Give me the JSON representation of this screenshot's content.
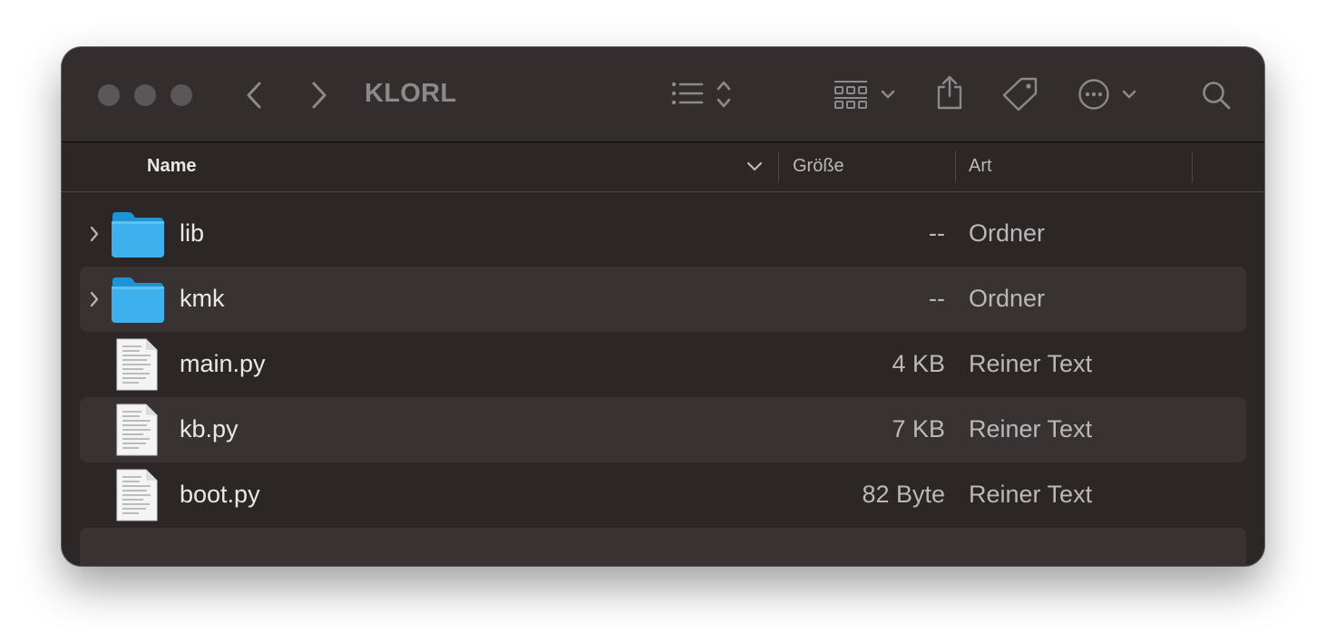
{
  "window": {
    "title": "KLORL",
    "background": "#2c2627",
    "accent_folder": "#3eb0ec"
  },
  "toolbar": {
    "icons": [
      "back-chevron-icon",
      "forward-chevron-icon",
      "list-view-icon",
      "group-grid-icon",
      "share-icon",
      "tag-icon",
      "more-actions-icon",
      "search-icon"
    ]
  },
  "columns": {
    "name": "Name",
    "size": "Größe",
    "kind": "Art"
  },
  "rows": [
    {
      "name": "lib",
      "size": "--",
      "kind": "Ordner",
      "type": "folder"
    },
    {
      "name": "kmk",
      "size": "--",
      "kind": "Ordner",
      "type": "folder"
    },
    {
      "name": "main.py",
      "size": "4 KB",
      "kind": "Reiner Text",
      "type": "text-file"
    },
    {
      "name": "kb.py",
      "size": "7 KB",
      "kind": "Reiner Text",
      "type": "text-file"
    },
    {
      "name": "boot.py",
      "size": "82 Byte",
      "kind": "Reiner Text",
      "type": "text-file"
    }
  ]
}
